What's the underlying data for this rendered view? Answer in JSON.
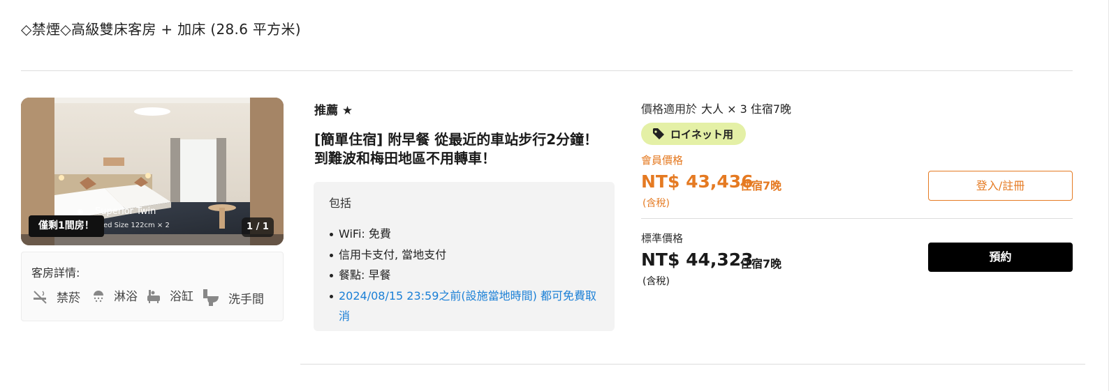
{
  "room": {
    "title": "◇禁煙◇高級雙床客房 + 加床 (28.6 平方米)"
  },
  "photo": {
    "caption": "Superior Twin",
    "caption_sub": "ed Size 122cm × 2",
    "rooms_left": "僅剩1間房！",
    "pager": "1 / 1"
  },
  "details": {
    "label": "客房詳情:",
    "amenities": [
      {
        "icon": "no-smoking-icon",
        "label": "禁菸"
      },
      {
        "icon": "shower-icon",
        "label": "淋浴"
      },
      {
        "icon": "bathtub-icon",
        "label": "浴缸"
      },
      {
        "icon": "toilet-icon",
        "label": "洗手間"
      }
    ]
  },
  "plan": {
    "recommend": "推薦 ★",
    "title": "[簡單住宿] 附早餐 從最近的車站步行2分鐘！到難波和梅田地區不用轉車！",
    "includes_label": "包括",
    "includes": [
      "WiFi: 免費",
      "信用卡支付, 當地支付",
      "餐點: 早餐",
      "2024/08/15 23:59之前(設施當地時間) 都可免費取消"
    ]
  },
  "pricing": {
    "price_for_label": "價格適用於",
    "price_for_value": "大人 × 3 住宿7晚",
    "tag": "ロイネット用",
    "member_label": "會員價格",
    "member_price": "NT$ 43,436",
    "member_nights": "住宿7晚",
    "member_tax": "(含稅)",
    "login_button": "登入/註冊",
    "standard_label": "標準價格",
    "standard_price": "NT$ 44,323",
    "standard_nights": "住宿7晚",
    "standard_tax": "(含稅)",
    "book_button": "預約"
  },
  "colors": {
    "accent": "#e57a22",
    "link": "#1a7fd6",
    "tag_bg": "#e4f0a6"
  }
}
